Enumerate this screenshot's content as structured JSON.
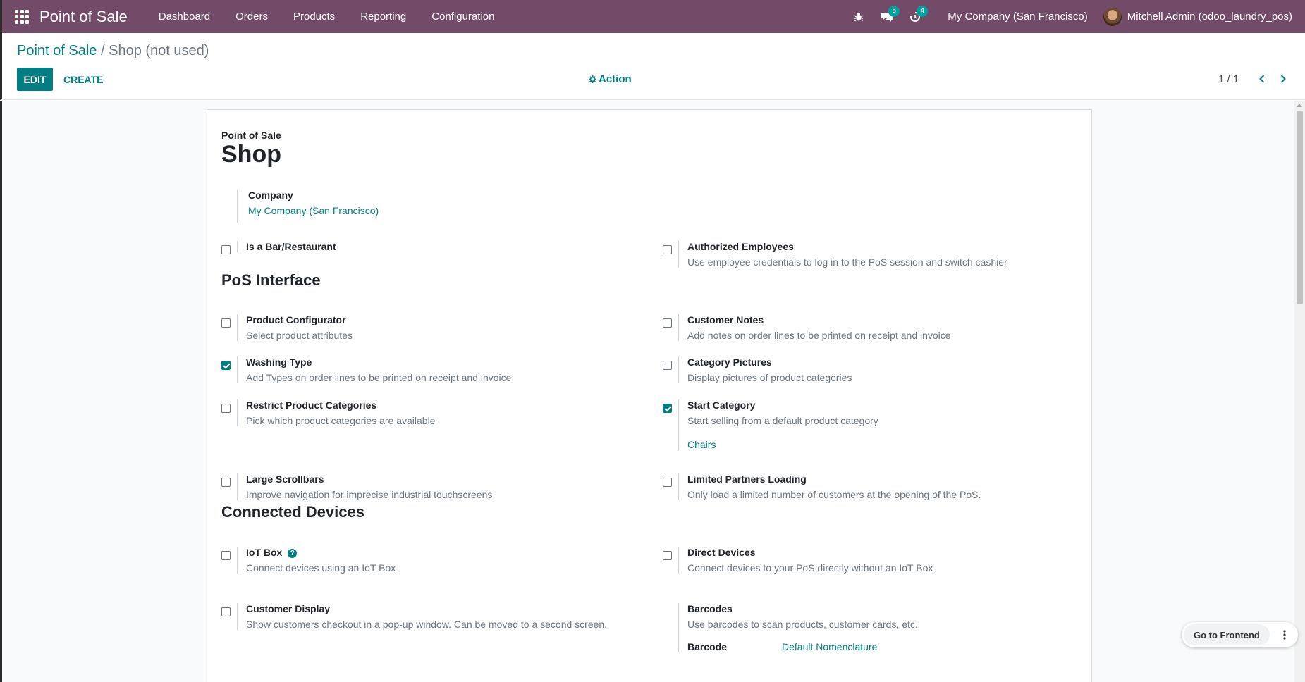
{
  "navbar": {
    "brand": "Point of Sale",
    "menu": [
      "Dashboard",
      "Orders",
      "Products",
      "Reporting",
      "Configuration"
    ],
    "messages_count": "5",
    "activities_count": "4",
    "company": "My Company (San Francisco)",
    "user": "Mitchell Admin (odoo_laundry_pos)"
  },
  "breadcrumb": {
    "parent": "Point of Sale",
    "separator": "/",
    "current": "Shop (not used)"
  },
  "toolbar": {
    "edit_label": "EDIT",
    "create_label": "CREATE",
    "action_label": "Action",
    "pager": "1 / 1"
  },
  "form": {
    "subtitle": "Point of Sale",
    "title": "Shop",
    "company_label": "Company",
    "company_value": "My Company (San Francisco)",
    "settings_top": [
      {
        "title": "Is a Bar/Restaurant",
        "desc": "",
        "checked": false
      },
      {
        "title": "Authorized Employees",
        "desc": "Use employee credentials to log in to the PoS session and switch cashier",
        "checked": false
      }
    ],
    "pos_interface": {
      "heading": "PoS Interface",
      "settings": [
        {
          "title": "Product Configurator",
          "desc": "Select product attributes",
          "checked": false
        },
        {
          "title": "Customer Notes",
          "desc": "Add notes on order lines to be printed on receipt and invoice",
          "checked": false
        },
        {
          "title": "Washing Type",
          "desc": "Add Types on order lines to be printed on receipt and invoice",
          "checked": true
        },
        {
          "title": "Category Pictures",
          "desc": "Display pictures of product categories",
          "checked": false
        },
        {
          "title": "Restrict Product Categories",
          "desc": "Pick which product categories are available",
          "checked": false
        },
        {
          "title": "Start Category",
          "desc": "Start selling from a default product category",
          "checked": true,
          "link": "Chairs"
        },
        {
          "title": "Large Scrollbars",
          "desc": "Improve navigation for imprecise industrial touchscreens",
          "checked": false
        },
        {
          "title": "Limited Partners Loading",
          "desc": "Only load a limited number of customers at the opening of the PoS.",
          "checked": false
        }
      ]
    },
    "connected_devices": {
      "heading": "Connected Devices",
      "settings": [
        {
          "title": "IoT Box",
          "desc": "Connect devices using an IoT Box",
          "checked": false
        },
        {
          "title": "Direct Devices",
          "desc": "Connect devices to your PoS directly without an IoT Box",
          "checked": false
        },
        {
          "title": "Customer Display",
          "desc": "Show customers checkout in a pop-up window. Can be moved to a second screen.",
          "checked": false
        },
        {
          "title": "Barcodes",
          "desc": "Use barcodes to scan products, customer cards, etc."
        }
      ],
      "barcode_label": "Barcode",
      "barcode_value": "Default Nomenclature"
    }
  },
  "floating": {
    "frontend_label": "Go to Frontend"
  },
  "colors": {
    "navbar": "#714b67",
    "primary": "#017e84",
    "badge": "#00a09d"
  }
}
